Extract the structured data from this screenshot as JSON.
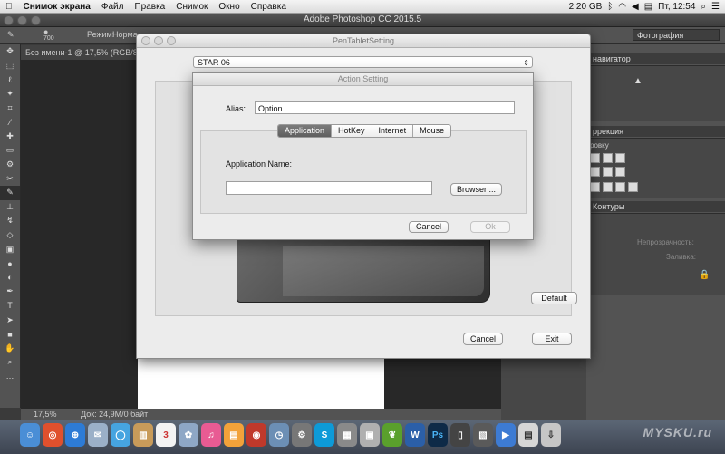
{
  "menubar": {
    "app_name": "Снимок экрана",
    "items": [
      "Файл",
      "Правка",
      "Снимок",
      "Окно",
      "Справка"
    ],
    "memory": "2.20 GB",
    "clock": "Пт, 12:54"
  },
  "photoshop": {
    "title": "Adobe Photoshop CC 2015.5",
    "brush_size": "700",
    "mode_label": "Режим:",
    "mode_value": "Норма",
    "workspace": "Фотография",
    "doc_tab": "Без имени-1 @ 17,5% (RGB/8)",
    "zoom": "17,5%",
    "doc_info": "Док: 24,9M/0 байт",
    "panels": {
      "navigator": "навигатор",
      "correction": "ррекция",
      "correction_sub": "ровку",
      "contours": "Контуры",
      "opacity": "Непрозрачность:",
      "fill": "Заливка:"
    }
  },
  "pts_window": {
    "title": "PenTabletSetting",
    "device": "STAR 06",
    "default_button": "Default",
    "cancel_button": "Cancel",
    "exit_button": "Exit"
  },
  "action_dialog": {
    "title": "Action Setting",
    "alias_label": "Alias:",
    "alias_value": "Option",
    "tabs": [
      {
        "label": "Application",
        "active": true
      },
      {
        "label": "HotKey",
        "active": false
      },
      {
        "label": "Internet",
        "active": false
      },
      {
        "label": "Mouse",
        "active": false
      }
    ],
    "app_name_label": "Application Name:",
    "app_name_value": "",
    "browse_button": "Browser ...",
    "cancel_button": "Cancel",
    "ok_button": "Ok"
  },
  "dock": {
    "watermark": "MYSKU.ru"
  },
  "colors": {
    "ps_dark": "#535353",
    "ps_canvas": "#282828",
    "dialog_bg": "#ececec",
    "tab_active": "#6a6a6a"
  }
}
